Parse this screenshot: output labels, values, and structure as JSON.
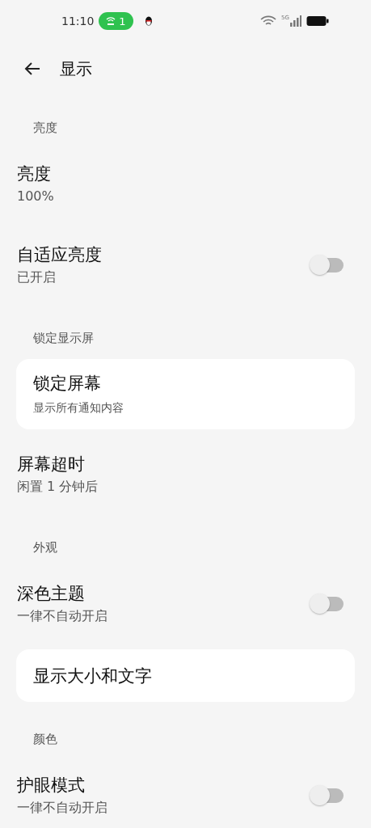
{
  "status_bar": {
    "time": "11:10",
    "hotspot_count": "1",
    "network": "5G"
  },
  "header": {
    "title": "显示"
  },
  "sections": [
    {
      "label": "亮度",
      "items": [
        {
          "kind": "plain",
          "title": "亮度",
          "subtitle": "100%"
        },
        {
          "kind": "switch",
          "title": "自适应亮度",
          "subtitle": "已开启",
          "on": false
        }
      ]
    },
    {
      "label": "锁定显示屏",
      "items": [
        {
          "kind": "card",
          "title": "锁定屏幕",
          "subtitle": "显示所有通知内容"
        },
        {
          "kind": "plain",
          "title": "屏幕超时",
          "subtitle": "闲置 1 分钟后"
        }
      ]
    },
    {
      "label": "外观",
      "items": [
        {
          "kind": "switch",
          "title": "深色主题",
          "subtitle": "一律不自动开启",
          "on": false
        },
        {
          "kind": "card",
          "title": "显示大小和文字"
        }
      ]
    },
    {
      "label": "颜色",
      "items": [
        {
          "kind": "switch",
          "title": "护眼模式",
          "subtitle": "一律不自动开启",
          "on": false
        }
      ]
    }
  ]
}
